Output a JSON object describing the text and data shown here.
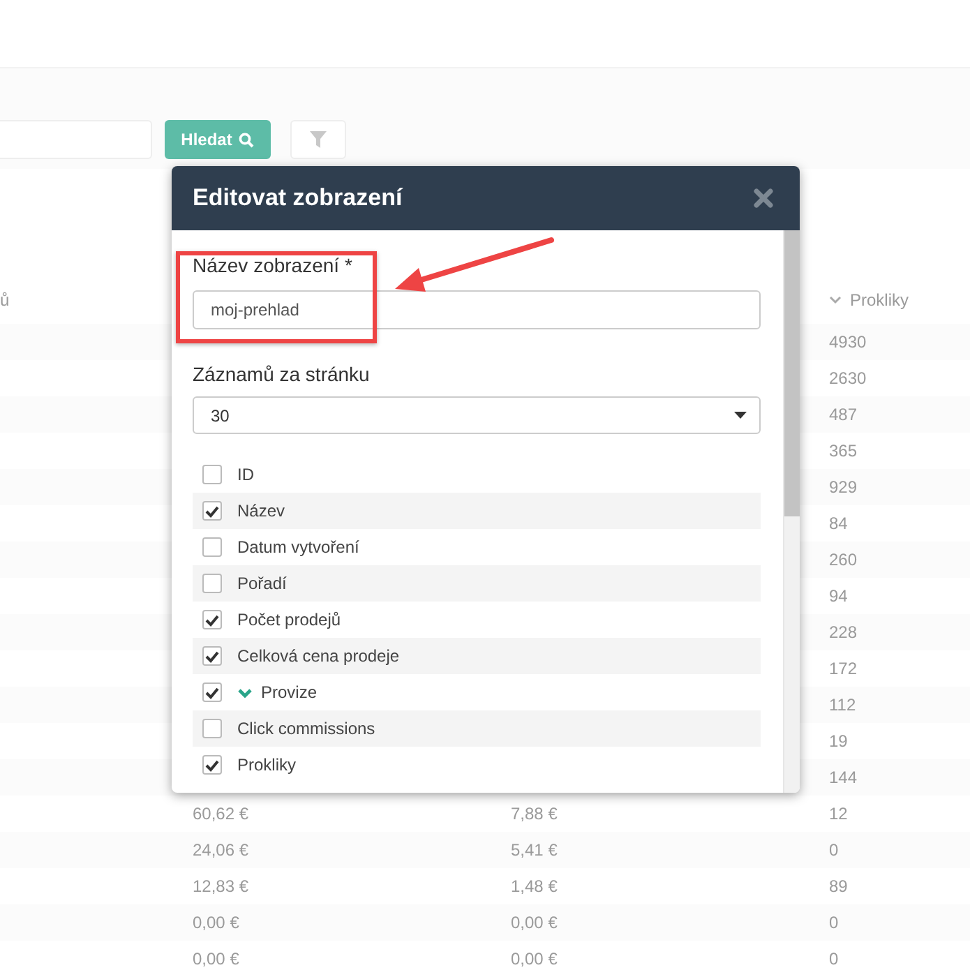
{
  "toolbar": {
    "search_button": "Hledat"
  },
  "table": {
    "columns": [
      "ů",
      "Prokliky"
    ],
    "rows": [
      {
        "prokliky": "4930"
      },
      {
        "prokliky": "2630"
      },
      {
        "prokliky": "487"
      },
      {
        "prokliky": "365"
      },
      {
        "prokliky": "929"
      },
      {
        "prokliky": "84"
      },
      {
        "prokliky": "260"
      },
      {
        "prokliky": "94"
      },
      {
        "prokliky": "228"
      },
      {
        "prokliky": "172"
      },
      {
        "prokliky": "112"
      },
      {
        "prokliky": "19"
      },
      {
        "prokliky": "144"
      },
      {
        "column_2": "60,62 €",
        "column_3": "7,88 €",
        "prokliky": "12"
      },
      {
        "column_2": "24,06 €",
        "column_3": "5,41 €",
        "prokliky": "0"
      },
      {
        "column_2": "12,83 €",
        "column_3": "1,48 €",
        "prokliky": "89"
      },
      {
        "column_2": "0,00 €",
        "column_3": "0,00 €",
        "prokliky": "0"
      },
      {
        "column_2": "0,00 €",
        "column_3": "0,00 €",
        "prokliky": "0"
      }
    ]
  },
  "dialog": {
    "title": "Editovat zobrazení",
    "name_field": {
      "label": "Název zobrazení *",
      "value": "moj-prehlad"
    },
    "per_page": {
      "label": "Záznamů za stránku",
      "value": "30"
    },
    "columns": [
      {
        "label": "ID",
        "checked": false,
        "sorted": false
      },
      {
        "label": "Název",
        "checked": true,
        "sorted": false
      },
      {
        "label": "Datum vytvoření",
        "checked": false,
        "sorted": false
      },
      {
        "label": "Pořadí",
        "checked": false,
        "sorted": false
      },
      {
        "label": "Počet prodejů",
        "checked": true,
        "sorted": false
      },
      {
        "label": "Celková cena prodeje",
        "checked": true,
        "sorted": false
      },
      {
        "label": "Provize",
        "checked": true,
        "sorted": true
      },
      {
        "label": "Click commissions",
        "checked": false,
        "sorted": false
      },
      {
        "label": "Prokliky",
        "checked": true,
        "sorted": false
      }
    ]
  }
}
